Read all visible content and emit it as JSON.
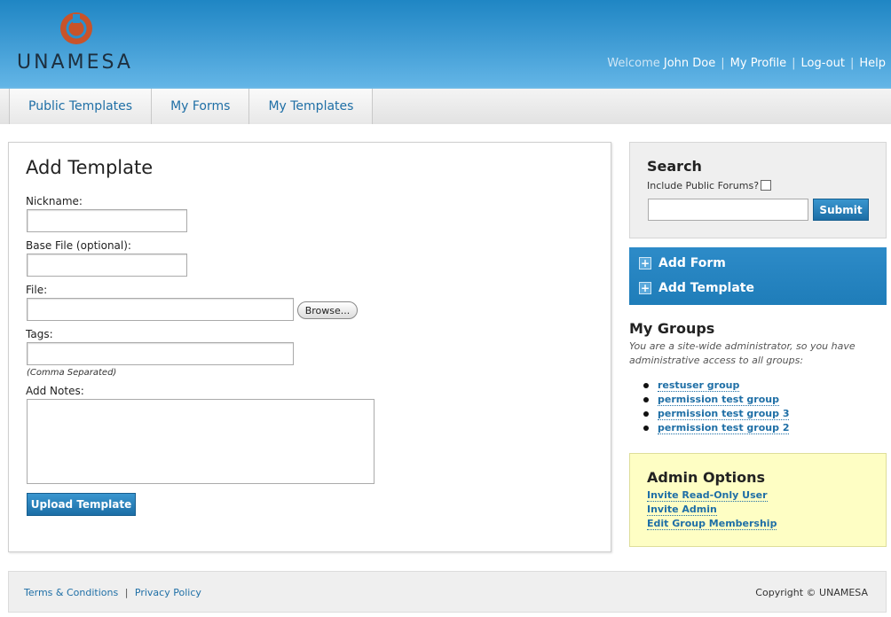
{
  "header": {
    "brand": "UNAMESA",
    "welcome_label": "Welcome",
    "user_name": "John Doe",
    "links": [
      "My Profile",
      "Log-out",
      "Help"
    ]
  },
  "nav": {
    "tabs": [
      "Public Templates",
      "My Forms",
      "My Templates"
    ]
  },
  "main": {
    "title": "Add Template",
    "nickname_label": "Nickname:",
    "base_file_label": "Base File (optional):",
    "file_label": "File:",
    "browse_label": "Browse...",
    "tags_label": "Tags:",
    "tags_hint": "(Comma Separated)",
    "notes_label": "Add Notes:",
    "upload_label": "Upload Template"
  },
  "search": {
    "title": "Search",
    "include_label": "Include Public Forums?",
    "submit_label": "Submit"
  },
  "actions": {
    "add_form": "Add Form",
    "add_template": "Add Template"
  },
  "groups": {
    "title": "My Groups",
    "description": "You are a site-wide administrator, so you have administrative access to all groups:",
    "items": [
      "restuser group",
      "permission test group",
      "permission test group 3",
      "permission test group 2"
    ]
  },
  "admin": {
    "title": "Admin Options",
    "links": [
      "Invite Read-Only User",
      "Invite Admin",
      "Edit Group Membership"
    ]
  },
  "footer": {
    "terms": "Terms & Conditions",
    "privacy": "Privacy Policy",
    "copyright": "Copyright © UNAMESA"
  },
  "colors": {
    "header_blue": "#2a8fcd",
    "link_blue": "#1f6fa6",
    "admin_bg": "#fefec4"
  }
}
